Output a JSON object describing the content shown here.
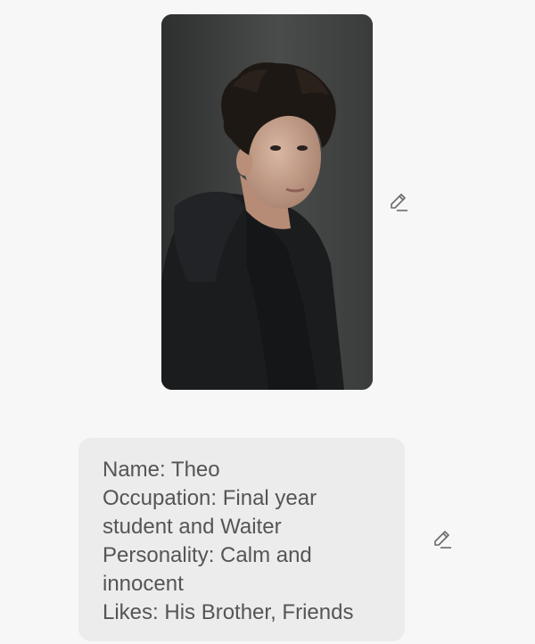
{
  "chat": {
    "image": {
      "alt": "",
      "icon": "edit-pencil-icon"
    },
    "message": {
      "lines": [
        "Name: Theo",
        "Occupation: Final year student and Waiter",
        "Personality: Calm and innocent",
        "Likes: His Brother, Friends"
      ],
      "icon": "edit-pencil-icon"
    }
  },
  "colors": {
    "background": "#f7f7f7",
    "bubble": "#ececec",
    "text": "#555555",
    "icon": "#6b6b6b"
  }
}
